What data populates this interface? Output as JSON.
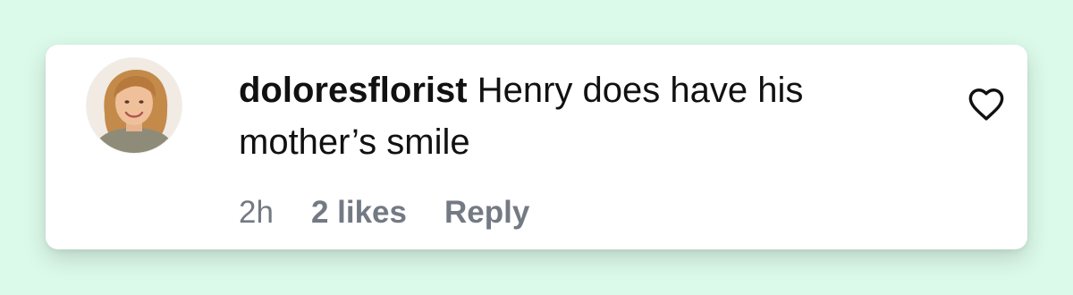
{
  "comment": {
    "username": "doloresflorist",
    "text": "Henry does have his mother’s smile",
    "time": "2h",
    "likes": "2 likes",
    "reply_label": "Reply"
  },
  "icons": {
    "like": "heart-outline-icon",
    "avatar": "profile-photo"
  },
  "colors": {
    "background": "#dcfaea",
    "card": "#ffffff",
    "text": "#111111",
    "meta_text": "#737a84"
  }
}
